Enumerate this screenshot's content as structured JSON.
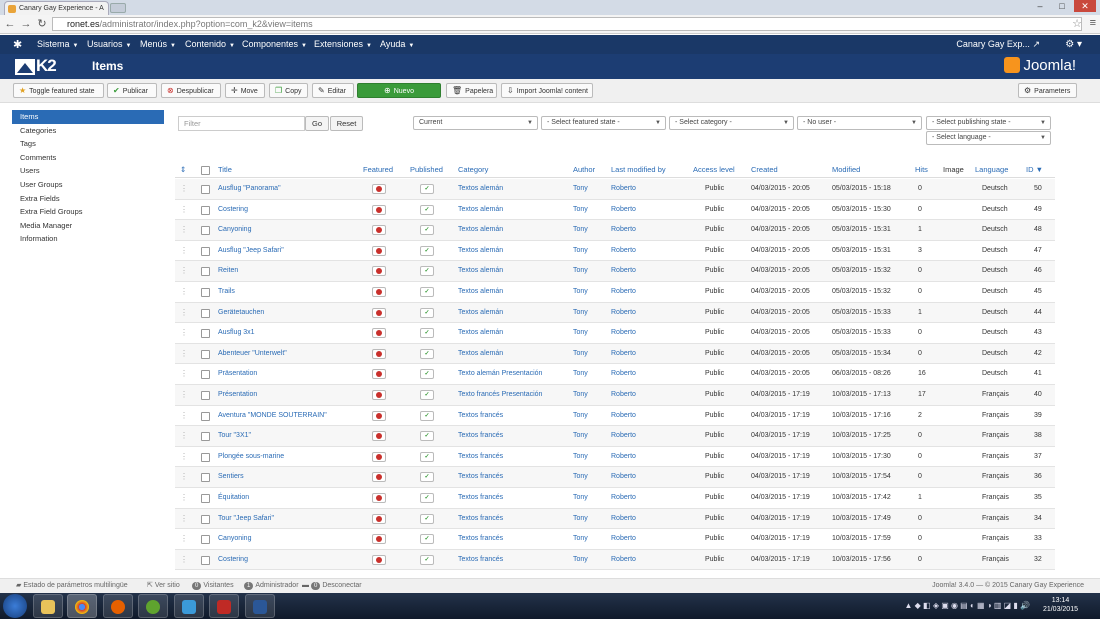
{
  "browser": {
    "tab_title": "Canary Gay Experience - A",
    "url_host": "ronet.es",
    "url_path": "/administrator/index.php?option=com_k2&view=items"
  },
  "topnav": {
    "menus": [
      "Sistema",
      "Usuarios",
      "Menús",
      "Contenido",
      "Componentes",
      "Extensiones",
      "Ayuda"
    ],
    "user": "Canary Gay Exp..."
  },
  "header": {
    "title": "Items",
    "k2_logo": "K2",
    "brand": "Joomla!"
  },
  "toolbar": {
    "toggle_featured": "Toggle featured state",
    "publish": "Publicar",
    "unpublish": "Despublicar",
    "move": "Move",
    "copy": "Copy",
    "edit": "Editar",
    "new": "Nuevo",
    "trash": "Papelera",
    "import": "Import Joomla! content",
    "parameters": "Parameters"
  },
  "sidebar": {
    "items": [
      "Items",
      "Categories",
      "Tags",
      "Comments",
      "Users",
      "User Groups",
      "Extra Fields",
      "Extra Field Groups",
      "Media Manager",
      "Information"
    ]
  },
  "filters": {
    "search_placeholder": "Filter",
    "go": "Go",
    "reset": "Reset",
    "state": "Current",
    "featured": "- Select featured state -",
    "category": "- Select category -",
    "user": "- No user -",
    "publishing": "- Select publishing state -",
    "language": "- Select language -"
  },
  "table": {
    "headers": {
      "title": "Title",
      "featured": "Featured",
      "published": "Published",
      "category": "Category",
      "author": "Author",
      "last_modified_by": "Last modified by",
      "access": "Access level",
      "created": "Created",
      "modified": "Modified",
      "hits": "Hits",
      "image": "Image",
      "language": "Language",
      "id": "ID"
    },
    "rows": [
      {
        "title": "Ausflug \"Panorama\"",
        "category": "Textos alemán",
        "author": "Tony",
        "modby": "Roberto",
        "access": "Public",
        "created": "04/03/2015 - 20:05",
        "modified": "05/03/2015 - 15:18",
        "hits": "0",
        "language": "Deutsch",
        "id": "50"
      },
      {
        "title": "Costering",
        "category": "Textos alemán",
        "author": "Tony",
        "modby": "Roberto",
        "access": "Public",
        "created": "04/03/2015 - 20:05",
        "modified": "05/03/2015 - 15:30",
        "hits": "0",
        "language": "Deutsch",
        "id": "49"
      },
      {
        "title": "Canyoning",
        "category": "Textos alemán",
        "author": "Tony",
        "modby": "Roberto",
        "access": "Public",
        "created": "04/03/2015 - 20:05",
        "modified": "05/03/2015 - 15:31",
        "hits": "1",
        "language": "Deutsch",
        "id": "48"
      },
      {
        "title": "Ausflug \"Jeep Safari\"",
        "category": "Textos alemán",
        "author": "Tony",
        "modby": "Roberto",
        "access": "Public",
        "created": "04/03/2015 - 20:05",
        "modified": "05/03/2015 - 15:31",
        "hits": "3",
        "language": "Deutsch",
        "id": "47"
      },
      {
        "title": "Reiten",
        "category": "Textos alemán",
        "author": "Tony",
        "modby": "Roberto",
        "access": "Public",
        "created": "04/03/2015 - 20:05",
        "modified": "05/03/2015 - 15:32",
        "hits": "0",
        "language": "Deutsch",
        "id": "46"
      },
      {
        "title": "Trails",
        "category": "Textos alemán",
        "author": "Tony",
        "modby": "Roberto",
        "access": "Public",
        "created": "04/03/2015 - 20:05",
        "modified": "05/03/2015 - 15:32",
        "hits": "0",
        "language": "Deutsch",
        "id": "45"
      },
      {
        "title": "Gerätetauchen",
        "category": "Textos alemán",
        "author": "Tony",
        "modby": "Roberto",
        "access": "Public",
        "created": "04/03/2015 - 20:05",
        "modified": "05/03/2015 - 15:33",
        "hits": "1",
        "language": "Deutsch",
        "id": "44"
      },
      {
        "title": "Ausflug 3x1",
        "category": "Textos alemán",
        "author": "Tony",
        "modby": "Roberto",
        "access": "Public",
        "created": "04/03/2015 - 20:05",
        "modified": "05/03/2015 - 15:33",
        "hits": "0",
        "language": "Deutsch",
        "id": "43"
      },
      {
        "title": "Abenteuer \"Unterwelt\"",
        "category": "Textos alemán",
        "author": "Tony",
        "modby": "Roberto",
        "access": "Public",
        "created": "04/03/2015 - 20:05",
        "modified": "05/03/2015 - 15:34",
        "hits": "0",
        "language": "Deutsch",
        "id": "42"
      },
      {
        "title": "Präsentation",
        "category": "Texto alemán Presentación",
        "author": "Tony",
        "modby": "Roberto",
        "access": "Public",
        "created": "04/03/2015 - 20:05",
        "modified": "06/03/2015 - 08:26",
        "hits": "16",
        "language": "Deutsch",
        "id": "41"
      },
      {
        "title": "Présentation",
        "category": "Texto francés Presentación",
        "author": "Tony",
        "modby": "Roberto",
        "access": "Public",
        "created": "04/03/2015 - 17:19",
        "modified": "10/03/2015 - 17:13",
        "hits": "17",
        "language": "Français",
        "id": "40"
      },
      {
        "title": "Aventura \"MONDE SOUTERRAIN\"",
        "category": "Textos francés",
        "author": "Tony",
        "modby": "Roberto",
        "access": "Public",
        "created": "04/03/2015 - 17:19",
        "modified": "10/03/2015 - 17:16",
        "hits": "2",
        "language": "Français",
        "id": "39"
      },
      {
        "title": "Tour \"3X1\"",
        "category": "Textos francés",
        "author": "Tony",
        "modby": "Roberto",
        "access": "Public",
        "created": "04/03/2015 - 17:19",
        "modified": "10/03/2015 - 17:25",
        "hits": "0",
        "language": "Français",
        "id": "38"
      },
      {
        "title": "Plongée sous-marine",
        "category": "Textos francés",
        "author": "Tony",
        "modby": "Roberto",
        "access": "Public",
        "created": "04/03/2015 - 17:19",
        "modified": "10/03/2015 - 17:30",
        "hits": "0",
        "language": "Français",
        "id": "37"
      },
      {
        "title": "Sentiers",
        "category": "Textos francés",
        "author": "Tony",
        "modby": "Roberto",
        "access": "Public",
        "created": "04/03/2015 - 17:19",
        "modified": "10/03/2015 - 17:54",
        "hits": "0",
        "language": "Français",
        "id": "36"
      },
      {
        "title": "Équitation",
        "category": "Textos francés",
        "author": "Tony",
        "modby": "Roberto",
        "access": "Public",
        "created": "04/03/2015 - 17:19",
        "modified": "10/03/2015 - 17:42",
        "hits": "1",
        "language": "Français",
        "id": "35"
      },
      {
        "title": "Tour \"Jeep Safari\"",
        "category": "Textos francés",
        "author": "Tony",
        "modby": "Roberto",
        "access": "Public",
        "created": "04/03/2015 - 17:19",
        "modified": "10/03/2015 - 17:49",
        "hits": "0",
        "language": "Français",
        "id": "34"
      },
      {
        "title": "Canyoning",
        "category": "Textos francés",
        "author": "Tony",
        "modby": "Roberto",
        "access": "Public",
        "created": "04/03/2015 - 17:19",
        "modified": "10/03/2015 - 17:59",
        "hits": "0",
        "language": "Français",
        "id": "33"
      },
      {
        "title": "Costering",
        "category": "Textos francés",
        "author": "Tony",
        "modby": "Roberto",
        "access": "Public",
        "created": "04/03/2015 - 17:19",
        "modified": "10/03/2015 - 17:56",
        "hits": "0",
        "language": "Français",
        "id": "32"
      }
    ]
  },
  "footer": {
    "multilang": "Estado de parámetros multilingüe",
    "view_site": "Ver sitio",
    "visitors_count": "0",
    "visitors": "Visitantes",
    "admin_count": "1",
    "admin": "Administrador",
    "logout_count": "0",
    "logout": "Desconectar",
    "version": "Joomla! 3.4.0 — © 2015 Canary Gay Experience"
  },
  "taskbar": {
    "time": "13:14",
    "date": "21/03/2015"
  },
  "colors": {
    "nav": "#1a3867",
    "header": "#1c3d73",
    "link": "#2a6bb5",
    "new_button": "#3a9b3a",
    "unpublished": "#c9302c"
  }
}
